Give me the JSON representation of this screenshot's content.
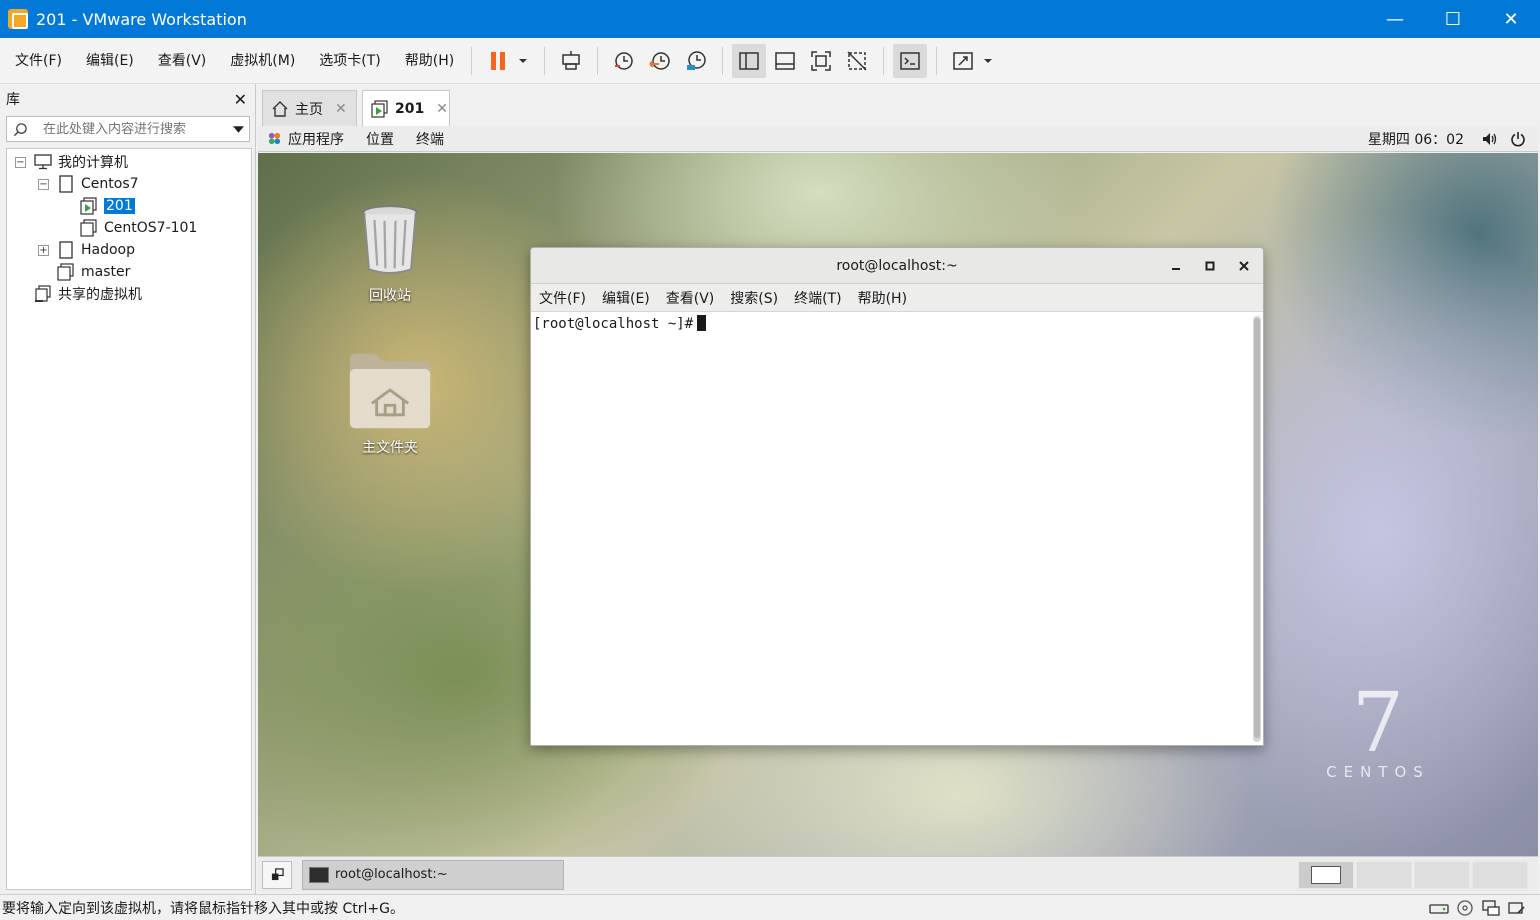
{
  "window": {
    "title": "201 - VMware Workstation",
    "controls": [
      "—",
      "☐",
      "✕"
    ]
  },
  "menu": [
    "文件(F)",
    "编辑(E)",
    "查看(V)",
    "虚拟机(M)",
    "选项卡(T)",
    "帮助(H)"
  ],
  "library": {
    "title": "库",
    "close": "✕",
    "search_placeholder": "在此处键入内容进行搜索",
    "tree": {
      "root": "我的计算机",
      "centos7": "Centos7",
      "vm_201": "201",
      "vm_centos101": "CentOS7-101",
      "hadoop": "Hadoop",
      "master": "master",
      "shared": "共享的虚拟机"
    }
  },
  "tabs": {
    "home": "主页",
    "vm": "201",
    "close": "✕"
  },
  "gnome": {
    "apps": "应用程序",
    "places": "位置",
    "terminal": "终端",
    "clock": "星期四 06：02"
  },
  "desktop": {
    "trash": "回收站",
    "home_folder": "主文件夹",
    "brand_number": "7",
    "brand_word": "CENTOS"
  },
  "terminal": {
    "title": "root@localhost:~",
    "menu": [
      "文件(F)",
      "编辑(E)",
      "查看(V)",
      "搜索(S)",
      "终端(T)",
      "帮助(H)"
    ],
    "prompt": "[root@localhost ~]#"
  },
  "taskbar": {
    "task": "root@localhost:~"
  },
  "status": {
    "text": "要将输入定向到该虚拟机，请将鼠标指针移入其中或按 Ctrl+G。"
  },
  "colors": {
    "titlebar": "#0078d7",
    "pause_accent": "#f26522",
    "vm_play_green": "#3aa03a"
  }
}
